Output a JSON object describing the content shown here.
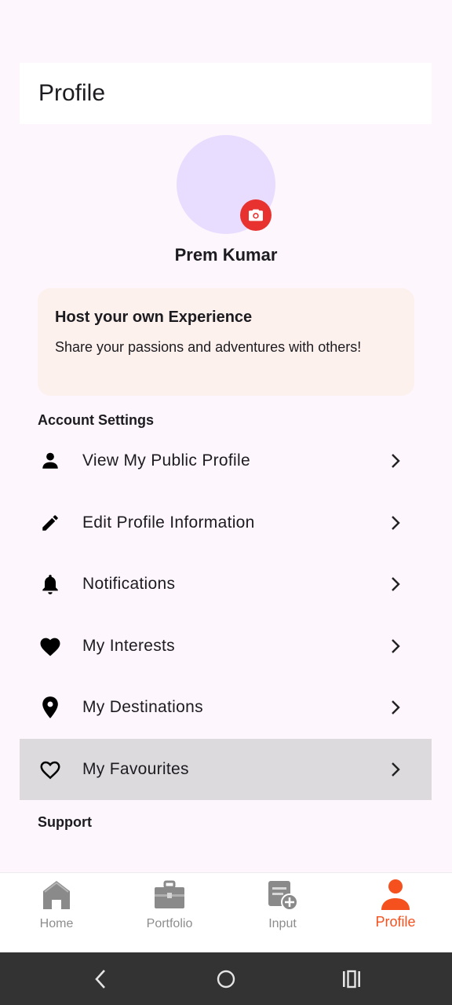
{
  "app_bar": {
    "title": "Profile"
  },
  "profile": {
    "name": "Prem Kumar"
  },
  "host_card": {
    "title": "Host your own Experience",
    "subtitle": "Share your passions and adventures with others!"
  },
  "sections": {
    "account_settings": "Account Settings",
    "support": "Support"
  },
  "menu": [
    {
      "label": "View My Public Profile",
      "icon": "person-icon"
    },
    {
      "label": "Edit Profile Information",
      "icon": "pencil-icon"
    },
    {
      "label": "Notifications",
      "icon": "bell-icon"
    },
    {
      "label": "My Interests",
      "icon": "heart-filled-icon"
    },
    {
      "label": "My Destinations",
      "icon": "location-pin-icon"
    },
    {
      "label": "My Favourites",
      "icon": "heart-outline-icon",
      "selected": true
    }
  ],
  "bottom_nav": [
    {
      "label": "Home",
      "icon": "home-icon"
    },
    {
      "label": "Portfolio",
      "icon": "briefcase-icon"
    },
    {
      "label": "Input",
      "icon": "add-document-icon"
    },
    {
      "label": "Profile",
      "icon": "profile-icon",
      "active": true
    }
  ],
  "colors": {
    "accent": "#f4511e",
    "camera_button": "#e7322f",
    "avatar_bg": "#e8dcff",
    "host_card_bg": "#fdf1ee",
    "selected_row": "#dcdadd"
  }
}
